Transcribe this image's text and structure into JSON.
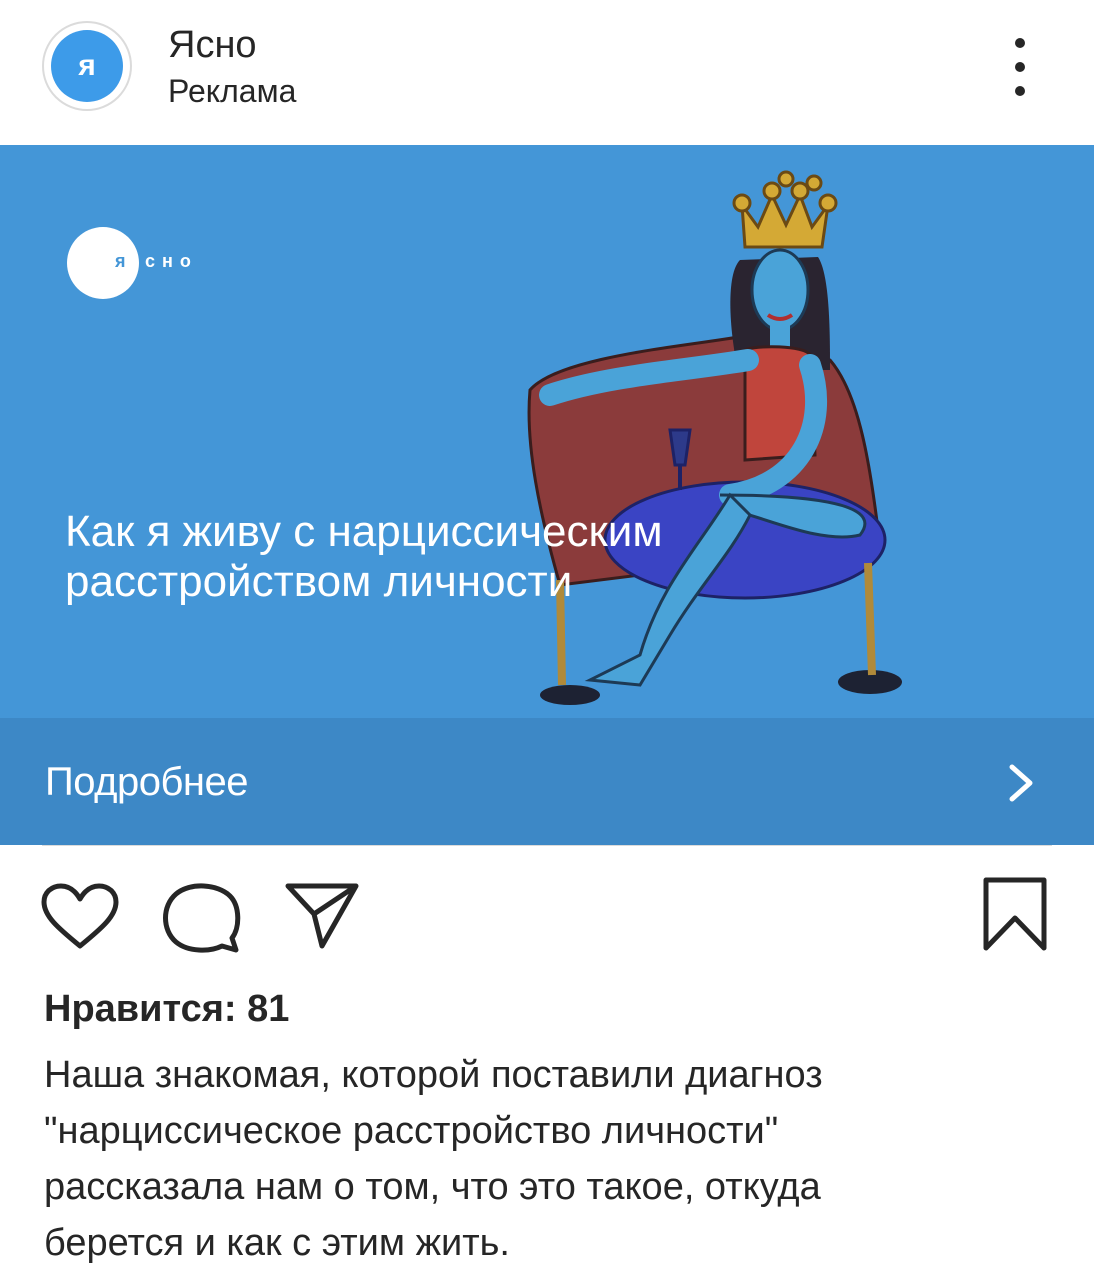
{
  "header": {
    "avatar_letter": "я",
    "account_name": "Ясно",
    "sponsored_label": "Реклама",
    "more_icon": "more-vertical-icon"
  },
  "ad": {
    "logo": {
      "letter": "я",
      "rest": "сно"
    },
    "headline_lines": [
      "Как я живу с нарциссическим",
      "расстройством личности"
    ],
    "illustration": "crowned-woman-on-sofa-illustration",
    "background_color": "#4496d7"
  },
  "cta": {
    "label": "Подробнее",
    "icon": "chevron-right-icon",
    "background_color": "#3d88c6"
  },
  "actions": {
    "like_icon": "heart-icon",
    "comment_icon": "comment-icon",
    "share_icon": "paper-plane-icon",
    "save_icon": "bookmark-icon"
  },
  "likes": {
    "text": "Нравится: 81"
  },
  "caption": {
    "lines": [
      "Наша знакомая, которой поставили диагноз",
      "\"нарциссическое расстройство личности\"",
      "рассказала нам о том, что это такое, откуда",
      "берется и как с этим жить."
    ]
  }
}
